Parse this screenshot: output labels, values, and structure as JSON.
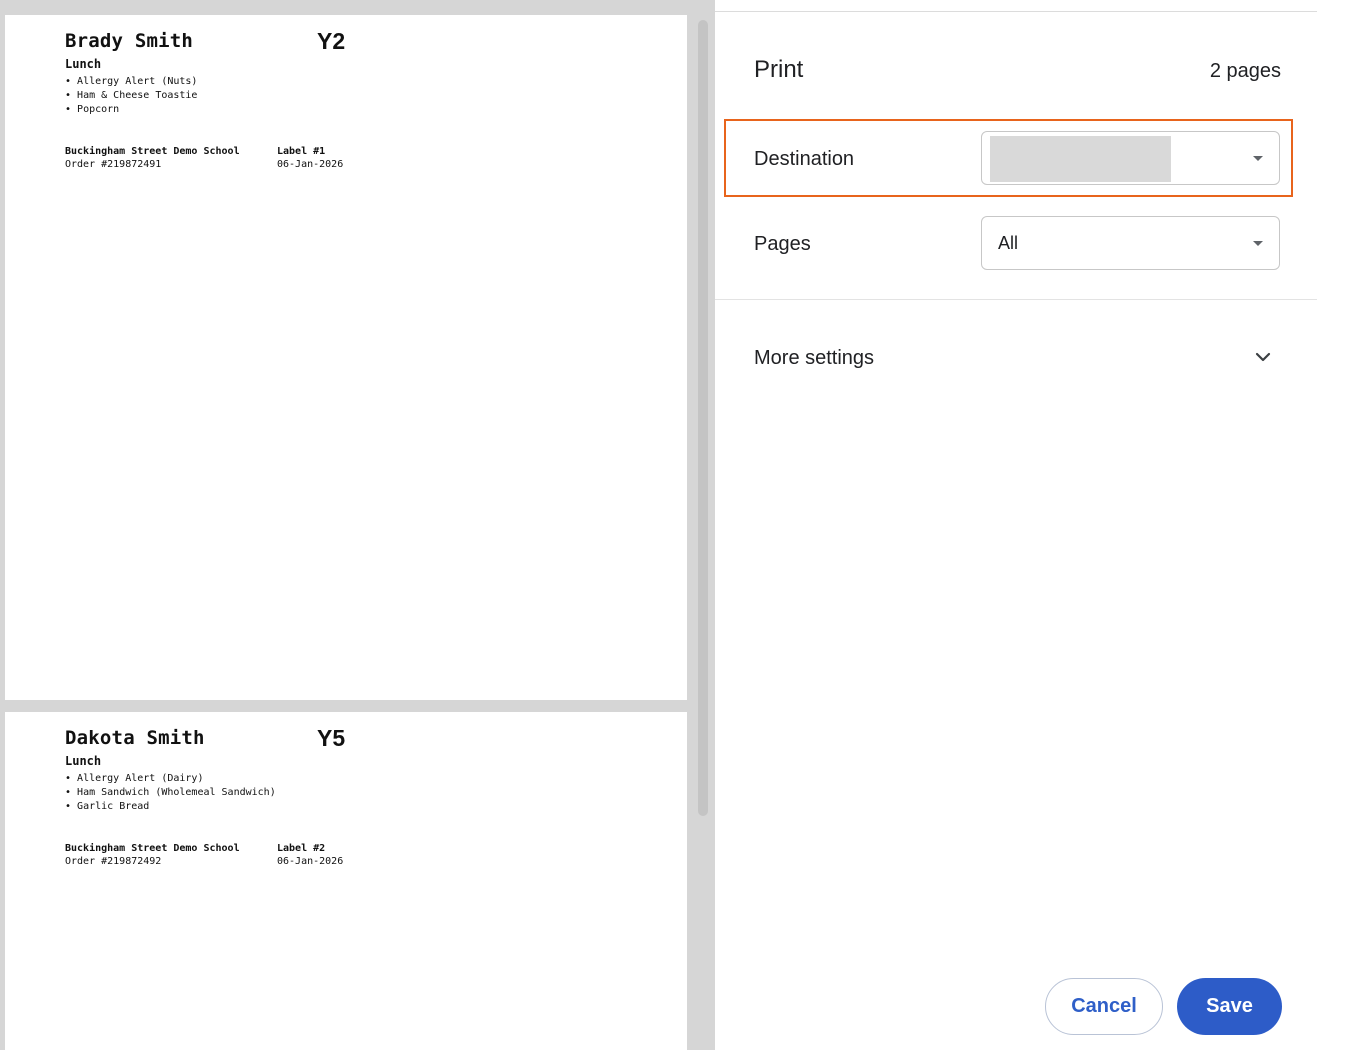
{
  "preview": {
    "labels": [
      {
        "name": "Brady Smith",
        "year": "Y2",
        "meal": "Lunch",
        "items": [
          "Allergy Alert  (Nuts)",
          "Ham & Cheese Toastie",
          "Popcorn"
        ],
        "school": "Buckingham Street Demo School",
        "order": "Order #219872491",
        "label_no": "Label #1",
        "date": "06-Jan-2026"
      },
      {
        "name": "Dakota Smith",
        "year": "Y5",
        "meal": "Lunch",
        "items": [
          "Allergy Alert  (Dairy)",
          "Ham Sandwich (Wholemeal Sandwich)",
          "Garlic Bread"
        ],
        "school": "Buckingham Street Demo School",
        "order": "Order #219872492",
        "label_no": "Label #2",
        "date": "06-Jan-2026"
      }
    ]
  },
  "panel": {
    "title": "Print",
    "page_count": "2 pages",
    "destination": {
      "label": "Destination",
      "value": ""
    },
    "pages": {
      "label": "Pages",
      "value": "All"
    },
    "more_settings": "More settings",
    "cancel": "Cancel",
    "save": "Save"
  },
  "colors": {
    "highlight": "#e8641c",
    "primary": "#2d5cc8"
  },
  "icons": {
    "dropdown": "caret-down-icon",
    "expand": "chevron-down-icon"
  }
}
